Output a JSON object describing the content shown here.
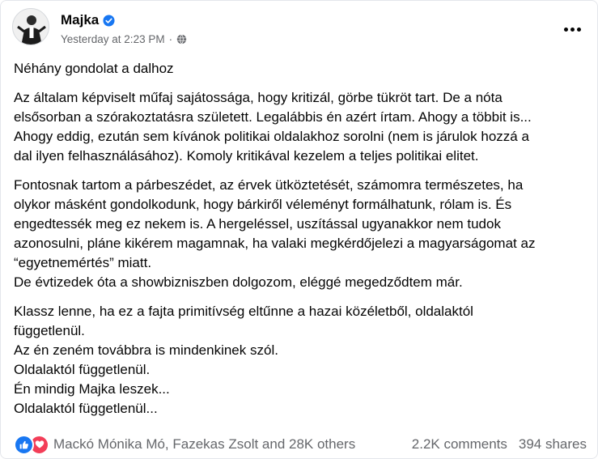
{
  "post": {
    "author": "Majka",
    "timestamp": "Yesterday at 2:23 PM",
    "separator": "·",
    "icons": {
      "verified": "verified-badge-icon",
      "audience": "globe-icon",
      "more": "more-options-icon",
      "like": "like-reaction-icon",
      "love": "love-reaction-icon"
    },
    "colors": {
      "verified": "#1877f2",
      "like": "#1877f2",
      "love": "#f33e58"
    },
    "paragraphs": [
      [
        "Néhány gondolat a dalhoz"
      ],
      [
        "Az általam képviselt műfaj sajátossága, hogy kritizál, görbe tükröt tart. De a nóta",
        "elsősorban a szórakoztatásra született. Legalábbis én azért írtam. Ahogy a többit is...",
        "Ahogy eddig, ezután sem kívánok politikai oldalakhoz sorolni (nem is járulok hozzá a",
        "dal ilyen felhasználásához). Komoly kritikával kezelem a teljes politikai elitet."
      ],
      [
        "Fontosnak tartom a párbeszédet, az érvek ütköztetését, számomra természetes, ha",
        "olykor másként gondolkodunk, hogy bárkiről véleményt formálhatunk, rólam is. És",
        "engedtessék meg ez nekem is. A hergeléssel, uszítással ugyanakkor nem tudok",
        "azonosulni, pláne kikérem magamnak, ha valaki megkérdőjelezi a magyarságomat az",
        "“egyetnemértés” miatt.",
        "De évtizedek óta a showbizniszben dolgozom, eléggé megedződtem már."
      ],
      [
        "Klassz lenne, ha ez a fajta primitívség eltűnne a hazai közéletből, oldalaktól",
        "függetlenül.",
        "Az én zeném továbbra is mindenkinek szól.",
        "Oldalaktól függetlenül.",
        "Én mindig Majka leszek...",
        "Oldalaktól függetlenül..."
      ]
    ],
    "reactions_text": "Mackó Mónika Mó, Fazekas Zsolt and 28K others",
    "comments_count": "2.2K comments",
    "shares_count": "394 shares"
  }
}
